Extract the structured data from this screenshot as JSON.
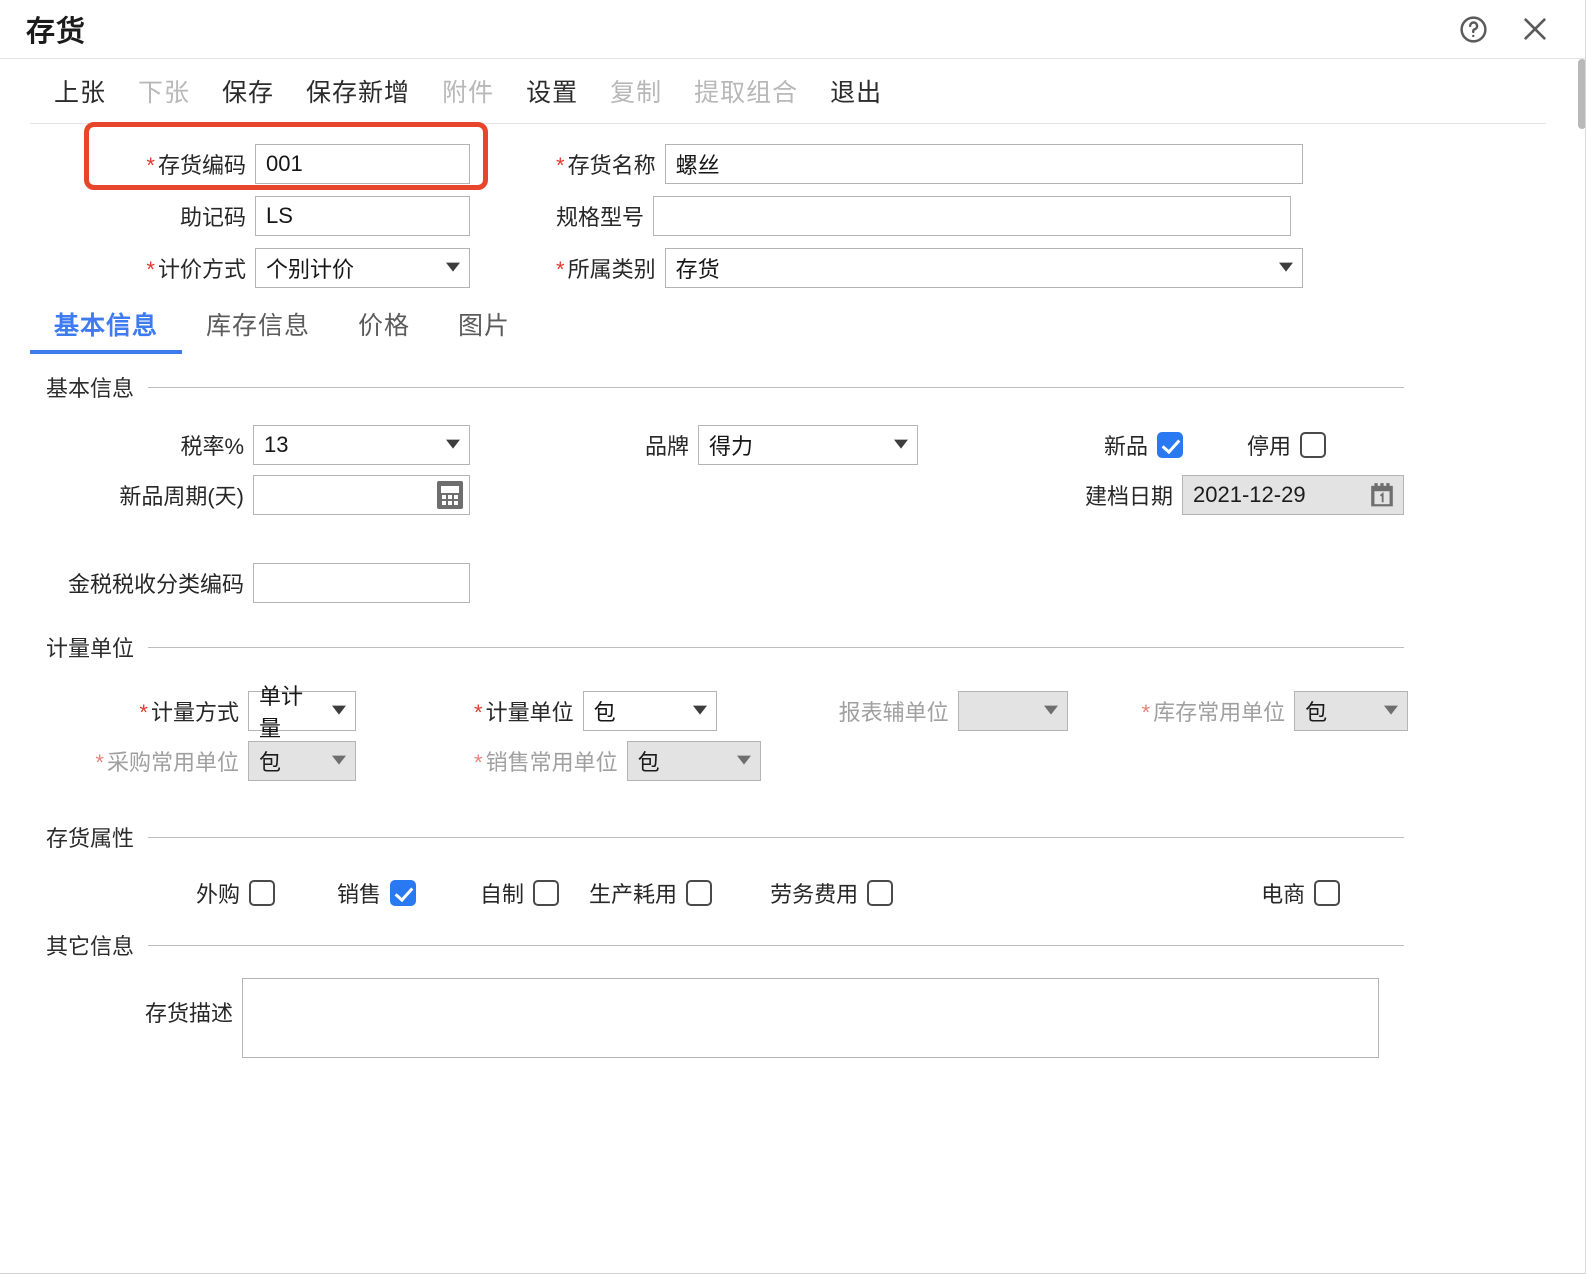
{
  "window": {
    "title": "存货",
    "help_icon": "help-circle-icon",
    "close_icon": "close-icon"
  },
  "toolbar": {
    "items": [
      {
        "label": "上张",
        "disabled": false
      },
      {
        "label": "下张",
        "disabled": true
      },
      {
        "label": "保存",
        "disabled": false
      },
      {
        "label": "保存新增",
        "disabled": false
      },
      {
        "label": "附件",
        "disabled": true
      },
      {
        "label": "设置",
        "disabled": false
      },
      {
        "label": "复制",
        "disabled": true
      },
      {
        "label": "提取组合",
        "disabled": true
      },
      {
        "label": "退出",
        "disabled": false
      }
    ]
  },
  "header_form": {
    "code": {
      "label": "存货编码",
      "required": true,
      "value": "001"
    },
    "name": {
      "label": "存货名称",
      "required": true,
      "value": "螺丝"
    },
    "mnemonic": {
      "label": "助记码",
      "required": false,
      "value": "LS"
    },
    "spec": {
      "label": "规格型号",
      "required": false,
      "value": ""
    },
    "pricing_method": {
      "label": "计价方式",
      "required": true,
      "value": "个别计价"
    },
    "category": {
      "label": "所属类别",
      "required": true,
      "value": "存货"
    }
  },
  "highlight": {
    "color": "#e8462c",
    "target": "存货编码"
  },
  "tabs": [
    {
      "label": "基本信息",
      "active": true
    },
    {
      "label": "库存信息",
      "active": false
    },
    {
      "label": "价格",
      "active": false
    },
    {
      "label": "图片",
      "active": false
    }
  ],
  "sections": {
    "basic": {
      "title": "基本信息",
      "tax_rate": {
        "label": "税率%",
        "value": "13"
      },
      "brand": {
        "label": "品牌",
        "value": "得力"
      },
      "new_product": {
        "label": "新品",
        "checked": true
      },
      "disabled_flag": {
        "label": "停用",
        "checked": false
      },
      "new_cycle": {
        "label": "新品周期(天)",
        "value": "",
        "icon": "calculator-icon"
      },
      "create_date": {
        "label": "建档日期",
        "value": "2021-12-29",
        "icon": "calendar-icon",
        "readonly": true
      },
      "tax_class_code": {
        "label": "金税税收分类编码",
        "value": ""
      }
    },
    "unit": {
      "title": "计量单位",
      "measure_method": {
        "label": "计量方式",
        "required": true,
        "value": "单计量",
        "disabled": false,
        "label_muted": false
      },
      "measure_unit": {
        "label": "计量单位",
        "required": true,
        "value": "包",
        "disabled": false,
        "label_muted": false
      },
      "report_aux_unit": {
        "label": "报表辅单位",
        "required": false,
        "value": "",
        "disabled": true,
        "label_muted": true
      },
      "stock_unit": {
        "label": "库存常用单位",
        "required": true,
        "value": "包",
        "disabled": true,
        "label_muted": true
      },
      "purchase_unit": {
        "label": "采购常用单位",
        "required": true,
        "value": "包",
        "disabled": true,
        "label_muted": true
      },
      "sales_unit": {
        "label": "销售常用单位",
        "required": true,
        "value": "包",
        "disabled": true,
        "label_muted": true
      }
    },
    "attributes": {
      "title": "存货属性",
      "items": [
        {
          "label": "外购",
          "checked": false
        },
        {
          "label": "销售",
          "checked": true
        },
        {
          "label": "自制",
          "checked": false
        },
        {
          "label": "生产耗用",
          "checked": false
        },
        {
          "label": "劳务费用",
          "checked": false
        },
        {
          "label": "电商",
          "checked": false
        }
      ]
    },
    "other": {
      "title": "其它信息",
      "description": {
        "label": "存货描述",
        "value": ""
      }
    }
  },
  "colors": {
    "accent": "#3e7bf0",
    "required": "#e23b2e",
    "highlight": "#e8462c",
    "checkbox_checked": "#2979f2"
  }
}
